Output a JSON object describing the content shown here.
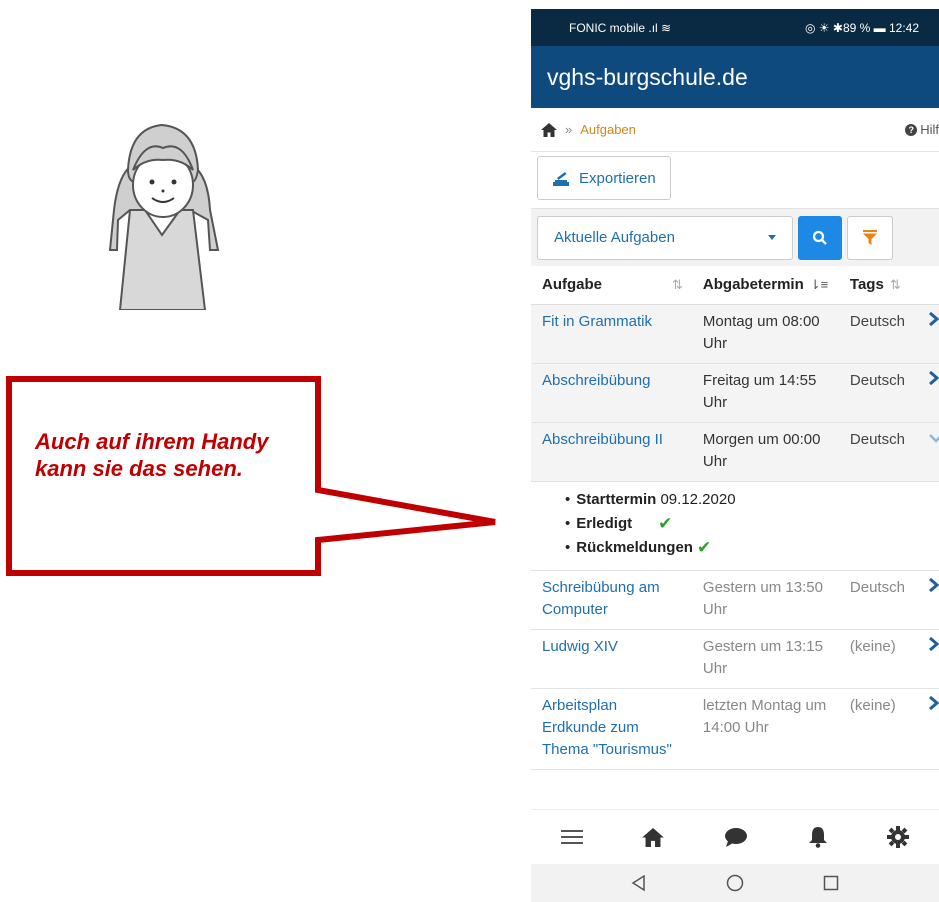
{
  "callout": {
    "text": "Auch auf ihrem Handy kann sie das sehen."
  },
  "status": {
    "carrier": "FONIC mobile",
    "battery": "89 %",
    "time": "12:42"
  },
  "app": {
    "title": "vghs-burgschule.de"
  },
  "breadcrumb": {
    "separator": "»",
    "current": "Aufgaben",
    "help": "Hilf"
  },
  "toolbar": {
    "export_label": "Exportieren"
  },
  "filter": {
    "selected": "Aktuelle Aufgaben"
  },
  "table": {
    "headers": {
      "task": "Aufgabe",
      "due": "Abgabetermin",
      "tags": "Tags"
    },
    "rows": [
      {
        "name": "Fit in Grammatik",
        "due": "Montag um 08:00 Uhr",
        "tags": "Deutsch"
      },
      {
        "name": "Abschreibübung",
        "due": "Freitag um 14:55 Uhr",
        "tags": "Deutsch"
      },
      {
        "name": "Abschreibübung II",
        "due": "Morgen um 00:00 Uhr",
        "tags": "Deutsch"
      },
      {
        "name": "Schreibübung am Computer",
        "due": "Gestern um 13:50 Uhr",
        "tags": "Deutsch"
      },
      {
        "name": "Ludwig XIV",
        "due": "Gestern um 13:15 Uhr",
        "tags": "(keine)"
      },
      {
        "name": "Arbeitsplan Erdkunde zum Thema \"Tourismus\"",
        "due": "letzten Montag um 14:00 Uhr",
        "tags": "(keine)"
      }
    ],
    "detail": {
      "start_label": "Starttermin",
      "start_value": "09.12.2020",
      "done_label": "Erledigt",
      "feedback_label": "Rückmeldungen"
    }
  },
  "colors": {
    "appbar": "#0e4a7e",
    "link": "#1f6fad",
    "callout": "#c00000",
    "search": "#1e88e5",
    "filter": "#f0820f"
  }
}
